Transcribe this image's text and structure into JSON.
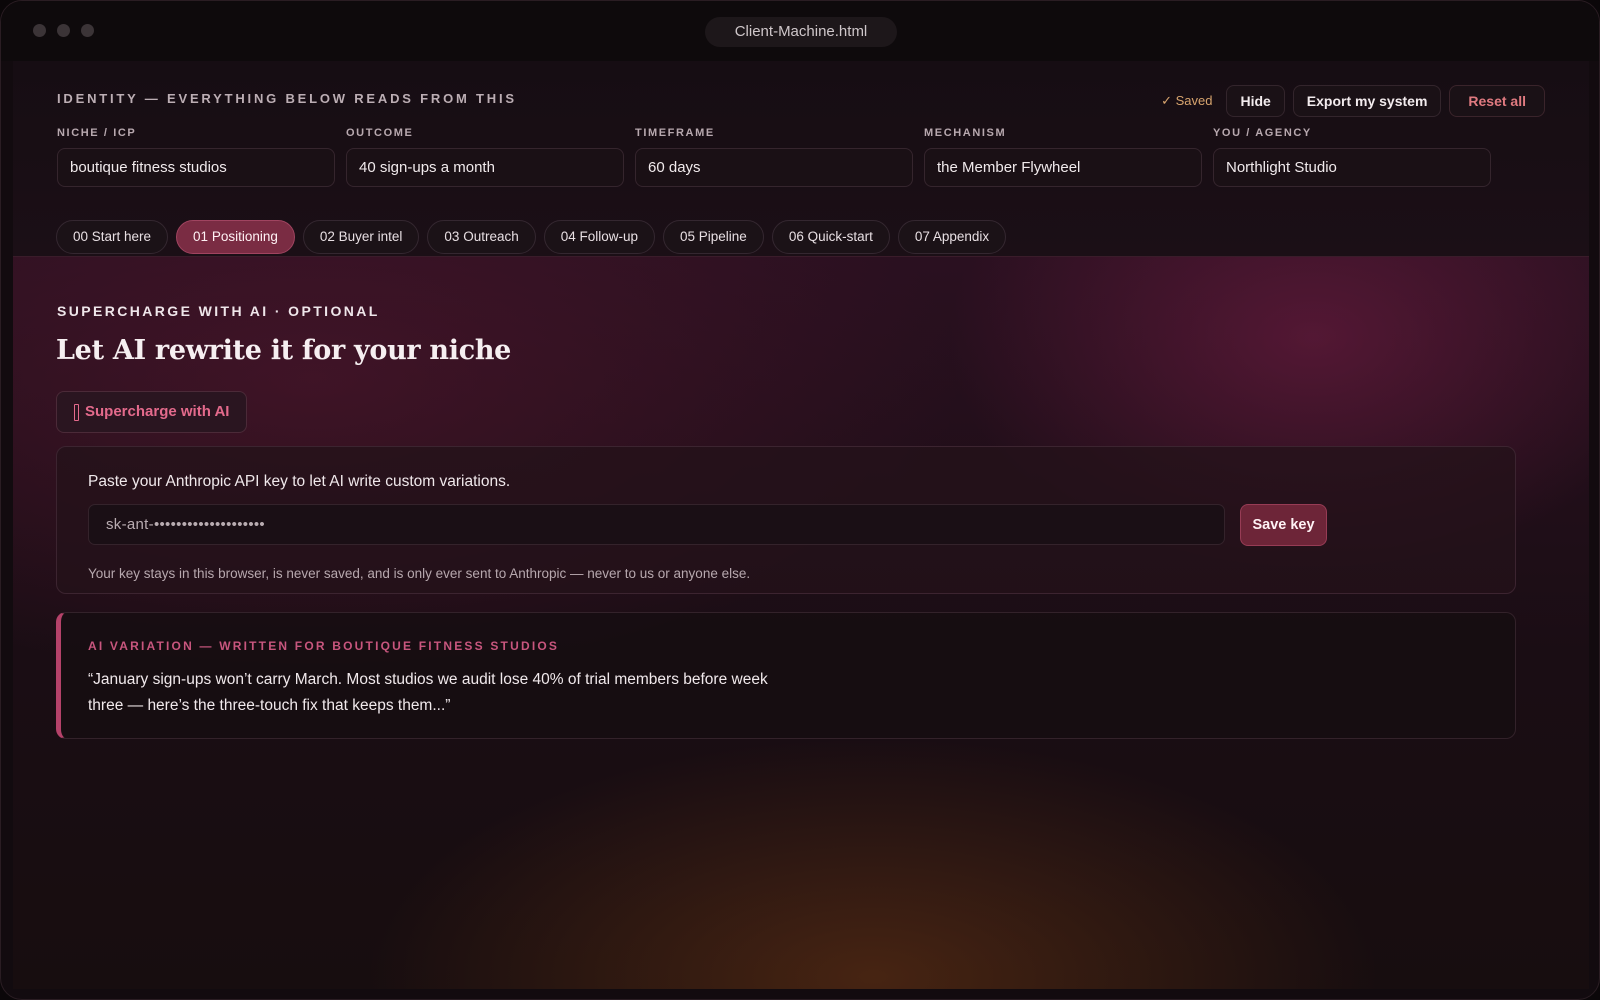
{
  "window": {
    "title": "Client-Machine.html"
  },
  "identity": {
    "heading": "IDENTITY — EVERYTHING BELOW READS FROM THIS",
    "status": "✓ Saved",
    "actions": {
      "hide": "Hide",
      "export": "Export my system",
      "reset": "Reset all"
    },
    "fields": [
      {
        "label": "NICHE / ICP",
        "value": "boutique fitness studios"
      },
      {
        "label": "OUTCOME",
        "value": "40 sign-ups a month"
      },
      {
        "label": "TIMEFRAME",
        "value": "60 days"
      },
      {
        "label": "MECHANISM",
        "value": "the Member Flywheel"
      },
      {
        "label": "YOU / AGENCY",
        "value": "Northlight Studio"
      }
    ]
  },
  "tabs": [
    {
      "label": "00 Start here",
      "active": false
    },
    {
      "label": "01 Positioning",
      "active": true
    },
    {
      "label": "02 Buyer intel",
      "active": false
    },
    {
      "label": "03 Outreach",
      "active": false
    },
    {
      "label": "04 Follow-up",
      "active": false
    },
    {
      "label": "05 Pipeline",
      "active": false
    },
    {
      "label": "06 Quick-start",
      "active": false
    },
    {
      "label": "07 Appendix",
      "active": false
    }
  ],
  "ai": {
    "eyebrow": "SUPERCHARGE WITH AI · OPTIONAL",
    "headline": "Let AI rewrite it for your niche",
    "button_label": "Supercharge with AI",
    "key_prompt": "Paste your Anthropic API key to let AI write custom variations.",
    "key_value": "sk-ant-••••••••••••••••••••",
    "save_label": "Save key",
    "key_note": "Your key stays in this browser, is never saved, and is only ever sent to Anthropic — never to us or anyone else."
  },
  "variation": {
    "label": "AI VARIATION — WRITTEN FOR BOUTIQUE FITNESS STUDIOS",
    "text": "“January sign-ups won’t carry March. Most studios we audit lose 40% of trial members before week three — here’s the three-touch fix that keeps them...”"
  },
  "colors": {
    "accent": "#b5426a",
    "active_tab": "#7a2c43",
    "saved": "#d7a46e",
    "reset": "#e07a80"
  }
}
